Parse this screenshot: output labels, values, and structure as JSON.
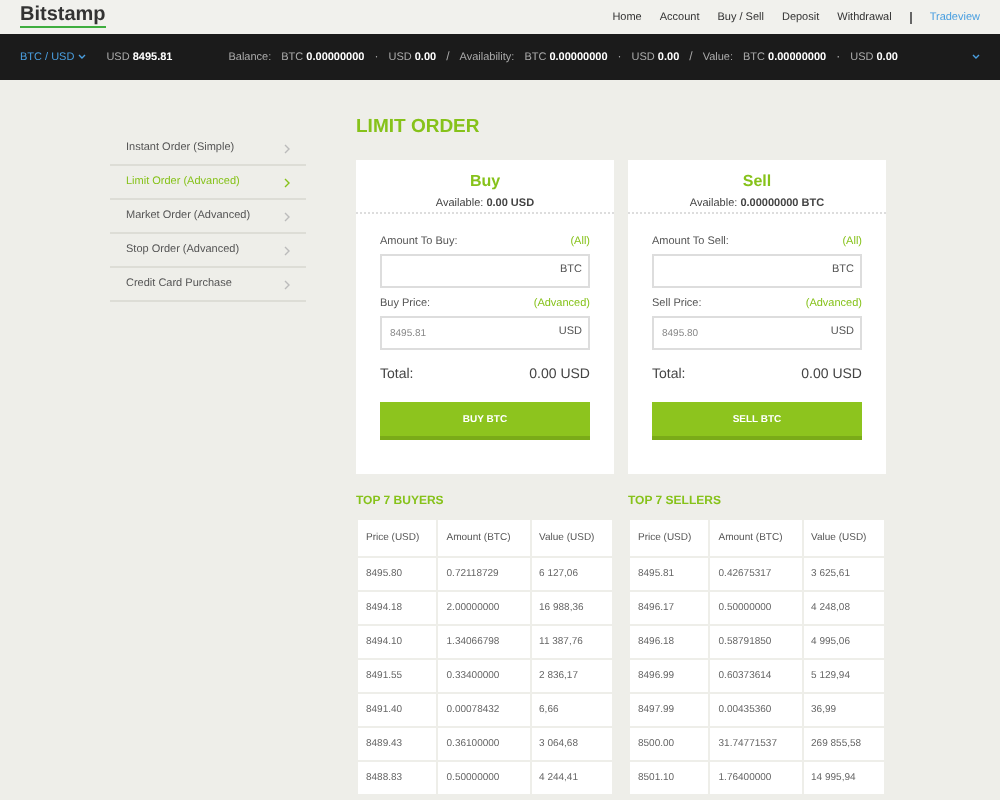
{
  "header": {
    "logo": "Bitstamp",
    "nav": [
      {
        "label": "Home",
        "kind": "page"
      },
      {
        "label": "Account",
        "kind": "page"
      },
      {
        "label": "Buy / Sell",
        "kind": "page"
      },
      {
        "label": "Deposit",
        "kind": "page"
      },
      {
        "label": "Withdrawal",
        "kind": "page"
      },
      {
        "label": "Tradeview",
        "kind": "highlight"
      }
    ]
  },
  "ticker": {
    "group_separator": "/",
    "part_separator": "·",
    "pair": "BTC / USD",
    "price_currency": "USD",
    "price": "8495.81",
    "groups": [
      {
        "label": "Balance:",
        "parts": [
          {
            "currency": "BTC",
            "amount": "0.00000000"
          },
          {
            "currency": "USD",
            "amount": "0.00"
          }
        ]
      },
      {
        "label": "Availability:",
        "parts": [
          {
            "currency": "BTC",
            "amount": "0.00000000"
          },
          {
            "currency": "USD",
            "amount": "0.00"
          }
        ]
      },
      {
        "label": "Value:",
        "parts": [
          {
            "currency": "BTC",
            "amount": "0.00000000"
          },
          {
            "currency": "USD",
            "amount": "0.00"
          }
        ]
      }
    ]
  },
  "sidebar": {
    "items": [
      {
        "label": "Instant Order (Simple)",
        "selected": false
      },
      {
        "label": "Limit Order (Advanced)",
        "selected": true
      },
      {
        "label": "Market Order (Advanced)",
        "selected": false
      },
      {
        "label": "Stop Order (Advanced)",
        "selected": false
      },
      {
        "label": "Credit Card Purchase",
        "selected": false
      }
    ]
  },
  "page_title": "LIMIT ORDER",
  "order_cards": [
    {
      "title": "Buy",
      "available_label": "Available:",
      "available": "0.00 USD",
      "fields": [
        {
          "label": "Amount To Buy:",
          "link": "(All)",
          "unit": "BTC"
        },
        {
          "label": "Buy Price:",
          "link": "(Advanced)",
          "placeholder": "8495.81",
          "unit": "USD"
        }
      ],
      "total_label": "Total:",
      "total": "0.00 USD",
      "button": "BUY BTC"
    },
    {
      "title": "Sell",
      "available_label": "Available:",
      "available": "0.00000000 BTC",
      "fields": [
        {
          "label": "Amount To Sell:",
          "link": "(All)",
          "unit": "BTC"
        },
        {
          "label": "Sell Price:",
          "link": "(Advanced)",
          "placeholder": "8495.80",
          "unit": "USD"
        }
      ],
      "total_label": "Total:",
      "total": "0.00 USD",
      "button": "SELL BTC"
    }
  ],
  "order_books": [
    {
      "title": "TOP 7 BUYERS",
      "columns": [
        "Price (USD)",
        "Amount (BTC)",
        "Value (USD)"
      ],
      "rows": [
        [
          "8495.80",
          "0.72118729",
          "6 127,06"
        ],
        [
          "8494.18",
          "2.00000000",
          "16 988,36"
        ],
        [
          "8494.10",
          "1.34066798",
          "11 387,76"
        ],
        [
          "8491.55",
          "0.33400000",
          "2 836,17"
        ],
        [
          "8491.40",
          "0.00078432",
          "6,66"
        ],
        [
          "8489.43",
          "0.36100000",
          "3 064,68"
        ],
        [
          "8488.83",
          "0.50000000",
          "4 244,41"
        ]
      ]
    },
    {
      "title": "TOP 7 SELLERS",
      "columns": [
        "Price (USD)",
        "Amount (BTC)",
        "Value (USD)"
      ],
      "rows": [
        [
          "8495.81",
          "0.42675317",
          "3 625,61"
        ],
        [
          "8496.17",
          "0.50000000",
          "4 248,08"
        ],
        [
          "8496.18",
          "0.58791850",
          "4 995,06"
        ],
        [
          "8496.99",
          "0.60373614",
          "5 129,94"
        ],
        [
          "8497.99",
          "0.00435360",
          "36,99"
        ],
        [
          "8500.00",
          "31.74771537",
          "269 855,58"
        ],
        [
          "8501.10",
          "1.76400000",
          "14 995,94"
        ]
      ]
    }
  ]
}
